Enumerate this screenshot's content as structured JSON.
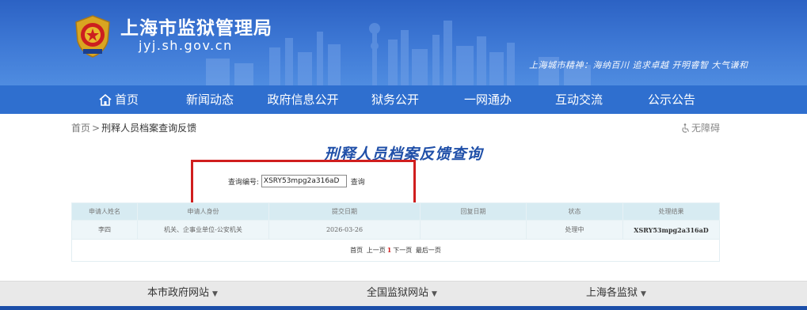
{
  "header": {
    "site_title": "上海市监狱管理局",
    "site_domain": "jyj.sh.gov.cn",
    "slogan": "上海城市精神：海纳百川 追求卓越 开明睿智 大气谦和"
  },
  "nav": {
    "items": [
      {
        "label": "首页"
      },
      {
        "label": "新闻动态"
      },
      {
        "label": "政府信息公开"
      },
      {
        "label": "狱务公开"
      },
      {
        "label": "一网通办"
      },
      {
        "label": "互动交流"
      },
      {
        "label": "公示公告"
      }
    ]
  },
  "breadcrumb": {
    "home": "首页",
    "separator": ">",
    "current": "刑释人员档案查询反馈"
  },
  "accessibility": {
    "label": "无障碍"
  },
  "page": {
    "title": "刑释人员档案反馈查询"
  },
  "query": {
    "label": "查询编号:",
    "value": "XSRY53mpg2a316aD",
    "button_label": "查询"
  },
  "table": {
    "headers": [
      "申请人姓名",
      "申请人身份",
      "提交日期",
      "回复日期",
      "状态",
      "处理结果"
    ],
    "rows": [
      [
        "李四",
        "机关、企事业单位-公安机关",
        "2026-03-26",
        "",
        "处理中",
        "XSRY53mpg2a316aD"
      ]
    ]
  },
  "pager": {
    "first": "首页",
    "prev": "上一页",
    "current": "1",
    "next": "下一页",
    "last": "最后一页"
  },
  "footer": {
    "items": [
      {
        "label": "本市政府网站"
      },
      {
        "label": "全国监狱网站"
      },
      {
        "label": "上海各监狱"
      }
    ]
  },
  "colors": {
    "banner": "#3f7ad6",
    "nav": "#2f6fcf",
    "title": "#1f4fa8",
    "highlight": "#d01e1e",
    "table_header": "#d7ebf2"
  }
}
